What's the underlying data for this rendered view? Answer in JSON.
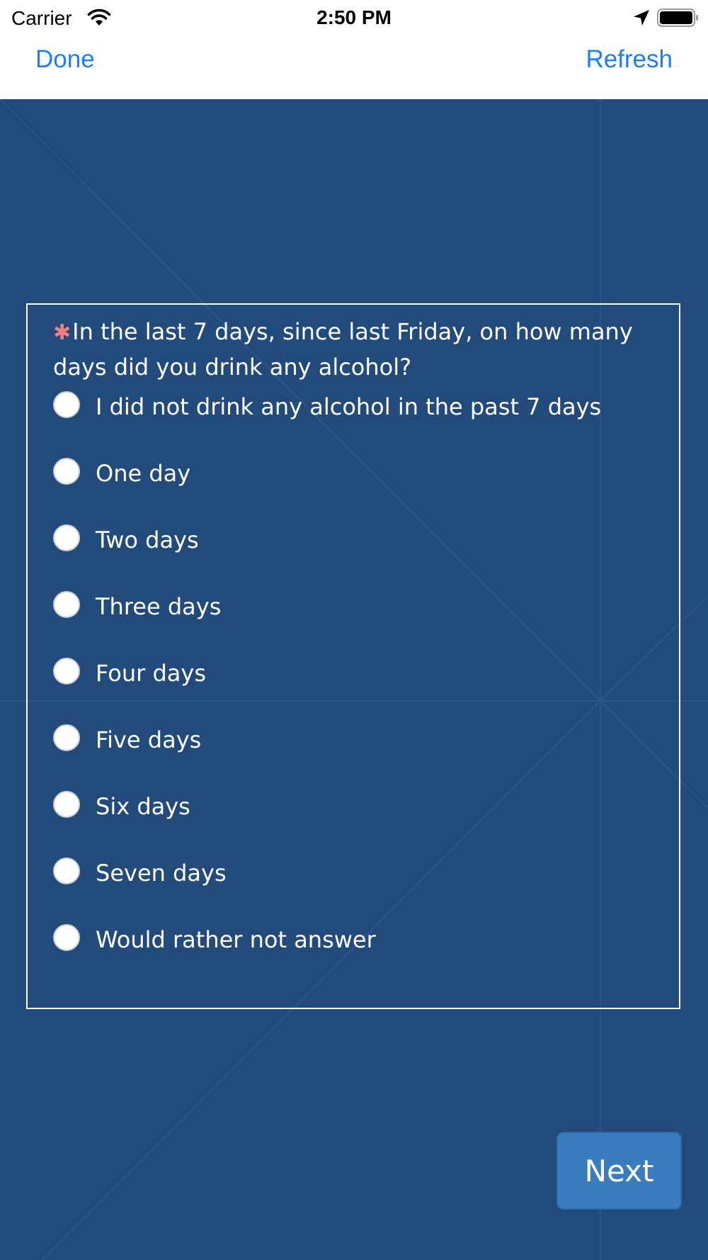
{
  "status_bar": {
    "carrier": "Carrier",
    "time": "2:50 PM",
    "icons": [
      "wifi-icon",
      "location-arrow-icon",
      "battery-icon"
    ]
  },
  "nav": {
    "done_label": "Done",
    "refresh_label": "Refresh"
  },
  "question": {
    "required_marker": "✱",
    "text": "In the last 7 days, since last Friday, on how many days did you drink any alcohol?",
    "options": [
      "I did not drink any alcohol in the past 7 days",
      "One day",
      "Two days",
      "Three days",
      "Four days",
      "Five days",
      "Six days",
      "Seven days",
      "Would rather not answer"
    ]
  },
  "footer": {
    "next_label": "Next"
  },
  "colors": {
    "accent": "#1e7ef7",
    "background": "#224b7b",
    "button": "#3a7dbe",
    "required": "#f47d7d"
  }
}
